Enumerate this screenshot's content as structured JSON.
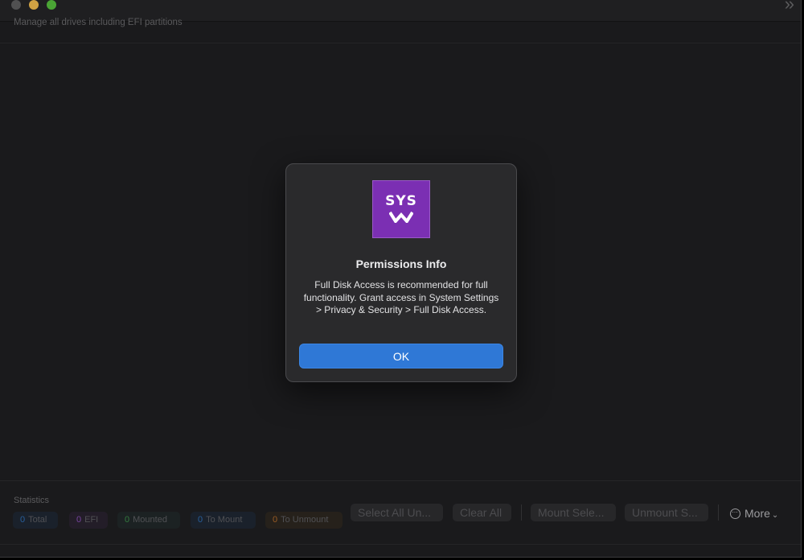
{
  "window": {
    "subtitle": "Manage all drives including EFI partitions"
  },
  "icons": {
    "expand": "double-chevron-right-icon",
    "more": "ellipsis-circle-icon",
    "chevron": "chevron-down-icon"
  },
  "statistics": {
    "label": "Statistics",
    "badges": [
      {
        "count": "0",
        "label": "Total",
        "color": "#2f6fb6"
      },
      {
        "count": "0",
        "label": "EFI",
        "color": "#8a4fb8"
      },
      {
        "count": "0",
        "label": "Mounted",
        "color": "#3c8f4a"
      },
      {
        "count": "0",
        "label": "To Mount",
        "color": "#2f6fb6"
      },
      {
        "count": "0",
        "label": "To Unmount",
        "color": "#b36b2b"
      }
    ]
  },
  "toolbar": {
    "select_all_label": "Select All Un...",
    "clear_all_label": "Clear All",
    "mount_selected_label": "Mount Sele...",
    "unmount_selected_label": "Unmount S...",
    "more_label": "More"
  },
  "dialog": {
    "logo_text": "SYS",
    "title": "Permissions Info",
    "message": "Full Disk Access is recommended for full functionality. Grant access in System Settings > Privacy & Security > Full Disk Access.",
    "ok_label": "OK",
    "accent_color": "#2f78d6",
    "logo_color": "#7b2fb3"
  }
}
